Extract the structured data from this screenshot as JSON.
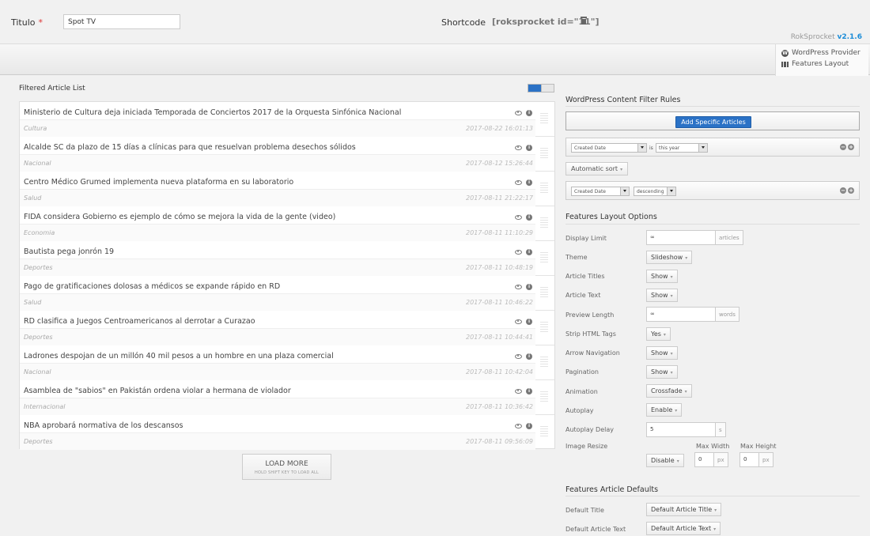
{
  "header": {
    "title_label": "Titulo",
    "required_mark": "*",
    "title_value": "Spot TV",
    "shortcode_label": "Shortcode",
    "shortcode_value": "[roksprocket id=\"11\"]",
    "brand_name": "RokSprocket",
    "brand_version": "v2.1.6"
  },
  "provider_box": {
    "provider": "WordPress Provider",
    "layout": "Features Layout"
  },
  "filtered_list": {
    "title": "Filtered Article List",
    "articles": [
      {
        "title": "Ministerio de Cultura deja iniciada Temporada de Conciertos 2017 de la Orquesta Sinfónica Nacional",
        "category": "Cultura",
        "date": "2017-08-22 16:01:13"
      },
      {
        "title": "Alcalde SC da plazo de 15 días a clínicas para que resuelvan problema desechos sólidos",
        "category": "Nacional",
        "date": "2017-08-12 15:26:44"
      },
      {
        "title": "Centro Médico Grumed implementa nueva plataforma en su laboratorio",
        "category": "Salud",
        "date": "2017-08-11 21:22:17"
      },
      {
        "title": "FIDA considera Gobierno es ejemplo de cómo se mejora la vida de la gente (video)",
        "category": "Economia",
        "date": "2017-08-11 11:10:29"
      },
      {
        "title": "Bautista pega jonrón 19",
        "category": "Deportes",
        "date": "2017-08-11 10:48:19"
      },
      {
        "title": "Pago de gratificaciones dolosas a médicos se expande rápido en RD",
        "category": "Salud",
        "date": "2017-08-11 10:46:22"
      },
      {
        "title": "RD clasifica a Juegos Centroamericanos al derrotar a Curazao",
        "category": "Deportes",
        "date": "2017-08-11 10:44:41"
      },
      {
        "title": "Ladrones despojan de un millón 40 mil pesos a un hombre en una plaza comercial",
        "category": "Nacional",
        "date": "2017-08-11 10:42:04"
      },
      {
        "title": "Asamblea de \"sabios\" en Pakistán ordena violar a hermana de violador",
        "category": "Internacional",
        "date": "2017-08-11 10:36:42"
      },
      {
        "title": "NBA aprobará normativa de los descansos",
        "category": "Deportes",
        "date": "2017-08-11 09:56:09"
      }
    ],
    "load_more_label": "LOAD MORE",
    "load_more_hint": "HOLD SHIFT KEY TO LOAD ALL"
  },
  "filter_rules": {
    "title": "WordPress Content Filter Rules",
    "add_button": "Add Specific Articles",
    "rule1": {
      "field": "Created Date",
      "op": "is",
      "value": "this year"
    },
    "sort_button": "Automatic sort",
    "rule2": {
      "field": "Created Date",
      "direction": "descending"
    }
  },
  "layout_options": {
    "title": "Features Layout Options",
    "display_limit": {
      "label": "Display Limit",
      "value": "∞",
      "unit": "articles"
    },
    "theme": {
      "label": "Theme",
      "value": "Slideshow"
    },
    "article_titles": {
      "label": "Article Titles",
      "value": "Show"
    },
    "article_text": {
      "label": "Article Text",
      "value": "Show"
    },
    "preview_length": {
      "label": "Preview Length",
      "value": "∞",
      "unit": "words"
    },
    "strip_html": {
      "label": "Strip HTML Tags",
      "value": "Yes"
    },
    "arrow_nav": {
      "label": "Arrow Navigation",
      "value": "Show"
    },
    "pagination": {
      "label": "Pagination",
      "value": "Show"
    },
    "animation": {
      "label": "Animation",
      "value": "Crossfade"
    },
    "autoplay": {
      "label": "Autoplay",
      "value": "Enable"
    },
    "autoplay_delay": {
      "label": "Autoplay Delay",
      "value": "5",
      "unit": "s"
    },
    "image_resize": {
      "label": "Image Resize",
      "value": "Disable",
      "max_width_label": "Max Width",
      "max_height_label": "Max Height",
      "max_width": "0",
      "max_height": "0",
      "unit": "px"
    }
  },
  "article_defaults": {
    "title": "Features Article Defaults",
    "default_title": {
      "label": "Default Title",
      "value": "Default Article Title"
    },
    "default_text": {
      "label": "Default Article Text",
      "value": "Default Article Text"
    }
  },
  "colors": {
    "accent": "#2b72c6",
    "required": "#dd3333",
    "version": "#1a8cd8"
  }
}
